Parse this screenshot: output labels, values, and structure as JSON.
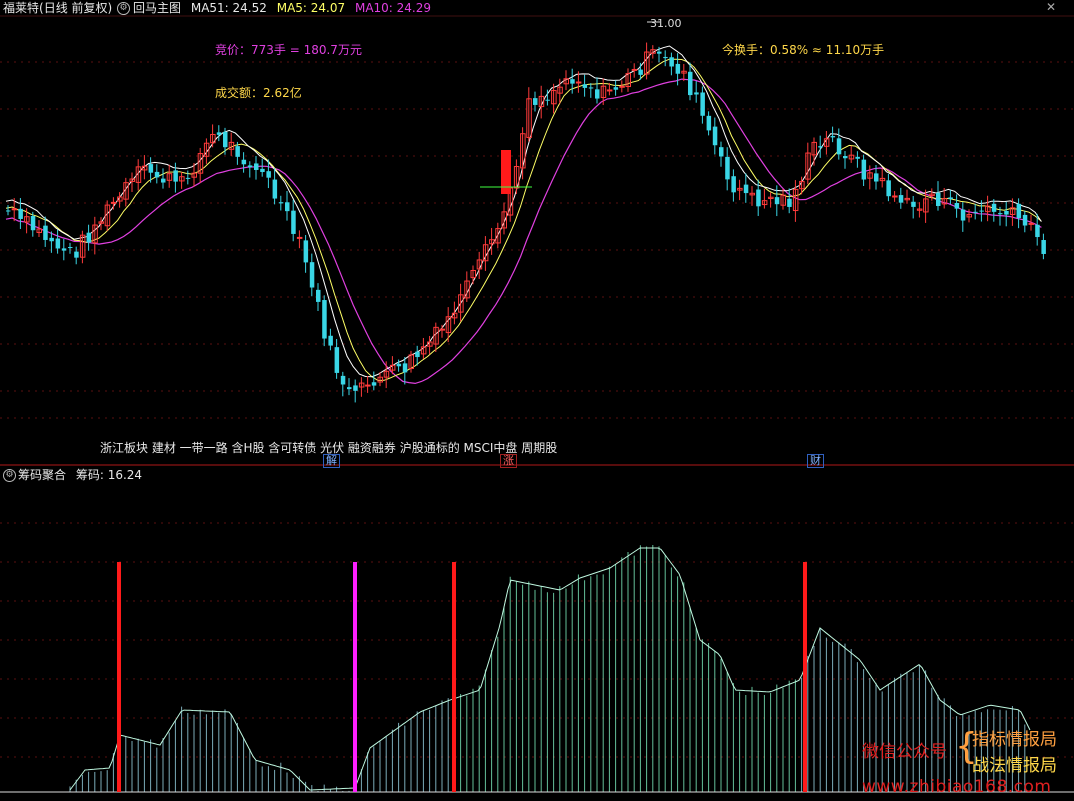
{
  "header": {
    "stock_name": "福莱特",
    "mode": "(日线 前复权)",
    "indicator": "回马主图",
    "ma51": "MA51: 24.52",
    "ma5": "MA5: 24.07",
    "ma10": "MA10: 24.29"
  },
  "main_panel": {
    "peak_label": "31.00",
    "bid_text": "竞价：773手 = 180.7万元",
    "turnover_amount": "成交额：2.62亿",
    "turnover_rate": "今换手：0.58% ≈ 11.10万手",
    "concept_line": "浙江板块 建材 一带一路 含H股 含可转债 光伏 融资融券 沪股通标的 MSCI中盘 周期股",
    "marks": [
      "解",
      "涨",
      "财"
    ]
  },
  "sub_panel": {
    "indicator": "筹码聚合",
    "value": "筹码: 16.24"
  },
  "watermark": {
    "wechat": "微信公众号",
    "line1": "指标情报局",
    "line2": "战法情报局",
    "url": "www.zhibiao168.com"
  },
  "colors": {
    "up": "#ff3b3b",
    "down": "#3ad6e6",
    "ma5": "#ffffff",
    "ma10": "#ffff66",
    "ma51": "#e040e0",
    "yellow_text": "#ffd84a",
    "magenta_text": "#e040e0",
    "orange": "#ffa040"
  }
}
